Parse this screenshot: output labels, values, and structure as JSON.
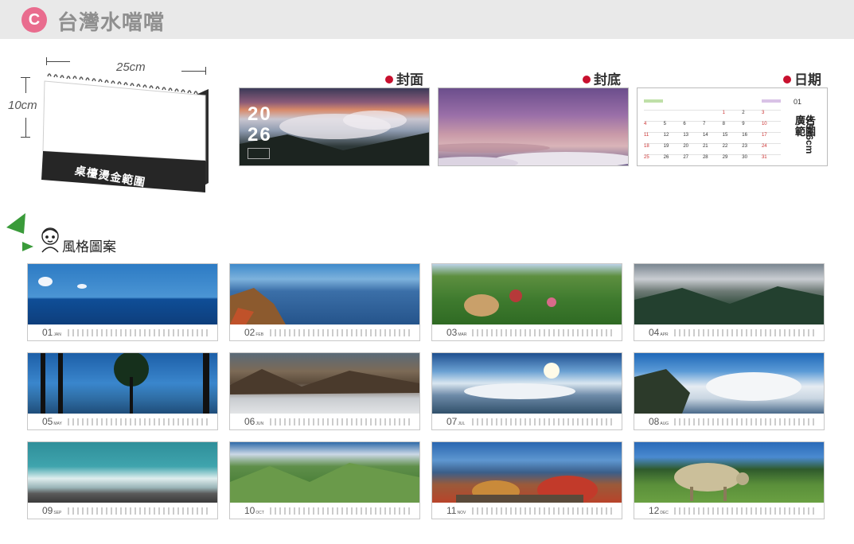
{
  "header": {
    "badge": "C",
    "title": "台灣水噹噹"
  },
  "mockup": {
    "width_label": "25cm",
    "height_label": "10cm",
    "foil_label": "桌檯燙金範圍"
  },
  "previews": {
    "cover_label": "封面",
    "back_label": "封底",
    "date_label": "日期",
    "cover_year_top": "20",
    "cover_year_bottom": "26",
    "date_month": "01",
    "ad_label": "廣告範圍",
    "ad_size": "3.5x6cm"
  },
  "style_section": {
    "title": "風格圖案"
  },
  "months": [
    {
      "num": "01",
      "abbr": "JAN"
    },
    {
      "num": "02",
      "abbr": "FEB"
    },
    {
      "num": "03",
      "abbr": "MAR"
    },
    {
      "num": "04",
      "abbr": "APR"
    },
    {
      "num": "05",
      "abbr": "MAY"
    },
    {
      "num": "06",
      "abbr": "JUN"
    },
    {
      "num": "07",
      "abbr": "JUL"
    },
    {
      "num": "08",
      "abbr": "AUG"
    },
    {
      "num": "09",
      "abbr": "SEP"
    },
    {
      "num": "10",
      "abbr": "OCT"
    },
    {
      "num": "11",
      "abbr": "NOV"
    },
    {
      "num": "12",
      "abbr": "DEC"
    }
  ],
  "colors": {
    "badge": "#e96c8e",
    "accent_red": "#c8102e",
    "header_bg": "#e9e9e9"
  }
}
